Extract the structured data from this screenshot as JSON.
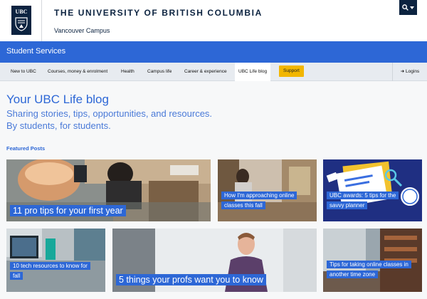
{
  "header": {
    "crest_text": "UBC",
    "university": "THE UNIVERSITY OF BRITISH COLUMBIA",
    "campus": "Vancouver Campus",
    "search_icon": "search-icon",
    "chevron_icon": "chevron-down-icon"
  },
  "unit": {
    "title": "Student Services"
  },
  "nav": {
    "items": [
      {
        "label": "New to UBC"
      },
      {
        "label": "Courses, money & enrolment"
      },
      {
        "label": "Health"
      },
      {
        "label": "Campus life"
      },
      {
        "label": "Career & experience"
      },
      {
        "label": "UBC Life blog"
      }
    ],
    "support": "Support",
    "login": "Logins",
    "login_icon": "sign-in-icon"
  },
  "main": {
    "title": "Your UBC Life blog",
    "subtitle_line1": "Sharing stories, tips, opportunities, and resources.",
    "subtitle_line2": "By students, for students.",
    "featured_label": "Featured Posts"
  },
  "posts": [
    {
      "caption": "11 pro tips for your first year"
    },
    {
      "caption": "How I'm approaching online classes this fall"
    },
    {
      "caption": "UBC awards: 5 tips for the savvy planner"
    },
    {
      "caption": "10 tech resources to know for fall"
    },
    {
      "caption": "5 things your profs want you to know"
    },
    {
      "caption": "Tips for taking online classes in another time zone"
    }
  ],
  "colors": {
    "navy": "#0c2340",
    "brand_blue": "#2d67d6",
    "support_yellow": "#f2b600",
    "nav_bg": "#e7ebf0"
  }
}
